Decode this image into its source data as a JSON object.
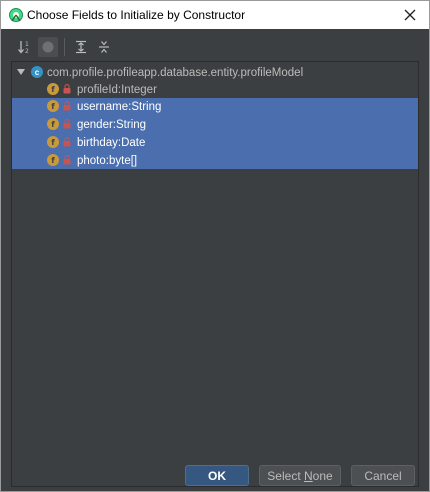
{
  "window": {
    "title": "Choose Fields to Initialize by Constructor",
    "icon": "android-studio-icon"
  },
  "toolbar": {
    "buttons": [
      {
        "icon": "sort-alphabetically-icon"
      },
      {
        "icon": "show-classes-icon"
      },
      {
        "icon": "expand-all-icon"
      },
      {
        "icon": "collapse-all-icon"
      }
    ]
  },
  "tree": {
    "class_icon_letter": "c",
    "field_icon_letter": "f",
    "root": {
      "label": "com.profile.profileapp.database.entity.profileModel",
      "expanded": true
    },
    "fields": [
      {
        "label": "profileId:Integer",
        "selected": false
      },
      {
        "label": "username:String",
        "selected": true
      },
      {
        "label": "gender:String",
        "selected": true
      },
      {
        "label": "birthday:Date",
        "selected": true
      },
      {
        "label": "photo:byte[]",
        "selected": true
      }
    ]
  },
  "buttons": {
    "ok": "OK",
    "select_none_prefix": "Select ",
    "select_none_mnemonic": "N",
    "select_none_suffix": "one",
    "cancel": "Cancel"
  },
  "colors": {
    "background": "#3c3f41",
    "selection": "#4b6eaf",
    "field_icon": "#c99a3c",
    "class_icon": "#3592c4",
    "ok_button": "#365880"
  }
}
